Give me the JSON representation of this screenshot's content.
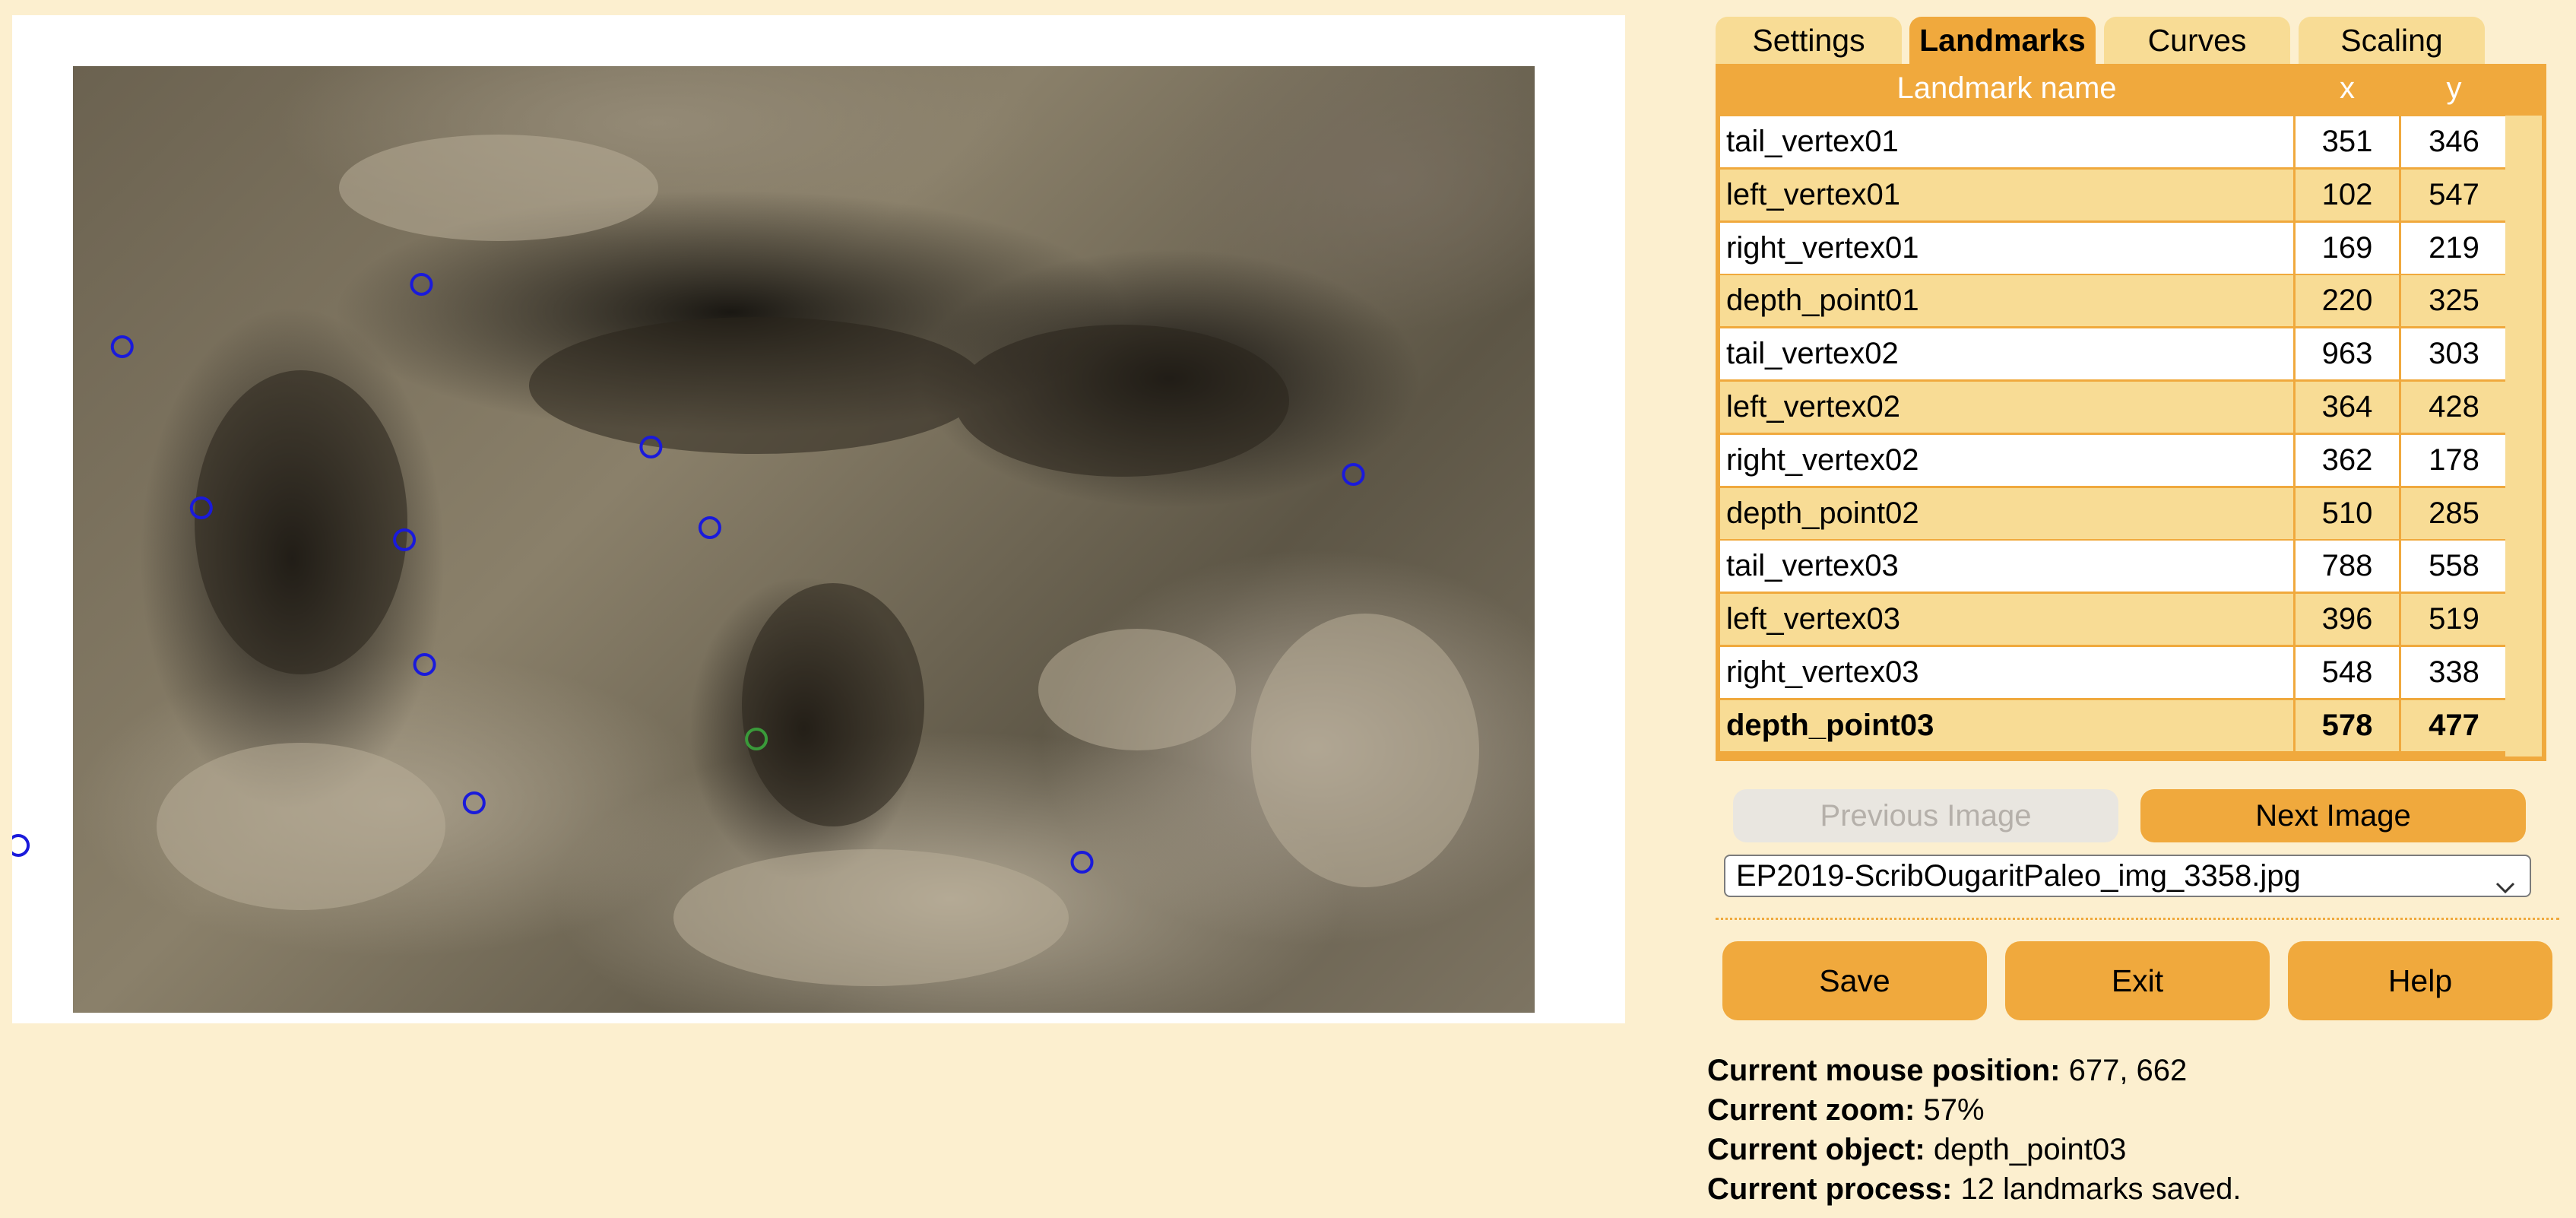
{
  "tabs": [
    {
      "label": "Settings"
    },
    {
      "label": "Landmarks"
    },
    {
      "label": "Curves"
    },
    {
      "label": "Scaling"
    }
  ],
  "table": {
    "headers": {
      "name": "Landmark name",
      "x": "x",
      "y": "y"
    },
    "rows": [
      {
        "name": "tail_vertex01",
        "x": "351",
        "y": "346"
      },
      {
        "name": "left_vertex01",
        "x": "102",
        "y": "547"
      },
      {
        "name": "right_vertex01",
        "x": "169",
        "y": "219"
      },
      {
        "name": "depth_point01",
        "x": "220",
        "y": "325"
      },
      {
        "name": "tail_vertex02",
        "x": "963",
        "y": "303"
      },
      {
        "name": "left_vertex02",
        "x": "364",
        "y": "428"
      },
      {
        "name": "right_vertex02",
        "x": "362",
        "y": "178"
      },
      {
        "name": "depth_point02",
        "x": "510",
        "y": "285"
      },
      {
        "name": "tail_vertex03",
        "x": "788",
        "y": "558"
      },
      {
        "name": "left_vertex03",
        "x": "396",
        "y": "519"
      },
      {
        "name": "right_vertex03",
        "x": "548",
        "y": "338"
      },
      {
        "name": "depth_point03",
        "x": "578",
        "y": "477"
      }
    ]
  },
  "navigation": {
    "previous_label": "Previous Image",
    "next_label": "Next Image"
  },
  "file_select": {
    "selected": "EP2019-ScribOugaritPaleo_img_3358.jpg"
  },
  "actions": {
    "save_label": "Save",
    "exit_label": "Exit",
    "help_label": "Help"
  },
  "status": {
    "mouse_label": "Current mouse position:",
    "mouse_value": "677, 662",
    "zoom_label": "Current zoom:",
    "zoom_value": "57%",
    "object_label": "Current object:",
    "object_value": "depth_point03",
    "process_label": "Current process:",
    "process_value": "12 landmarks saved."
  },
  "landmark_colors": {
    "saved": "#1a1adb",
    "selected": "#3a9a3a"
  },
  "colors": {
    "accent": "#f0a93d",
    "light": "#f8dc95",
    "background": "#fcefcf"
  }
}
